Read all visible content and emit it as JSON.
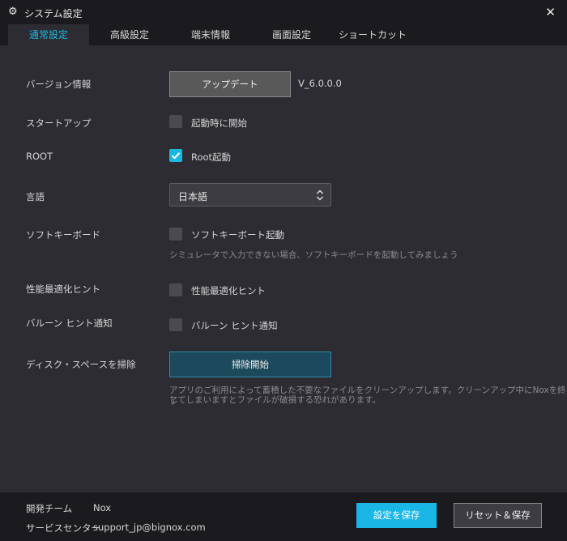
{
  "window": {
    "title": "システム設定"
  },
  "tabs": [
    {
      "label": "通常設定"
    },
    {
      "label": "高級設定"
    },
    {
      "label": "端末情報"
    },
    {
      "label": "画面設定"
    },
    {
      "label": "ショートカット"
    }
  ],
  "settings": {
    "version": {
      "label": "バージョン情報",
      "button": "アップデート",
      "value": "V_6.0.0.0"
    },
    "startup": {
      "label": "スタートアップ",
      "checkbox": "起動時に開始",
      "checked": false
    },
    "root": {
      "label": "ROOT",
      "checkbox": "Root起動",
      "checked": true
    },
    "language": {
      "label": "言語",
      "selected": "日本語"
    },
    "softkeyboard": {
      "label": "ソフトキーボード",
      "checkbox": "ソフトキーボート起動",
      "checked": false,
      "hint": "シミュレータで入力できない場合、ソフトキーボードを起動してみましょう"
    },
    "perf_hint": {
      "label": "性能最適化ヒント",
      "checkbox": "性能最適化ヒント",
      "checked": false
    },
    "balloon": {
      "label": "バルーン ヒント通知",
      "checkbox": "バルーン ヒント通知",
      "checked": false
    },
    "disk": {
      "label": "ディスク・スペースを掃除",
      "button": "掃除開始",
      "hint_line1": "アプリのご利用によって蓄積した不要なファイルをクリーンアップします。クリーンアップ中にNoxを終了",
      "hint_line2": "してしまいますとファイルが破損する恐れがあります。"
    }
  },
  "footer": {
    "team_label": "開発チーム",
    "team_value": "Nox",
    "service_label": "サービスセンター",
    "service_value": "support_jp@bignox.com",
    "save_button": "設定を保存",
    "reset_button": "リセット＆保存"
  },
  "colors": {
    "accent": "#19b8e3",
    "background": "#2c2c32",
    "titlebar": "#1b1b1f"
  }
}
